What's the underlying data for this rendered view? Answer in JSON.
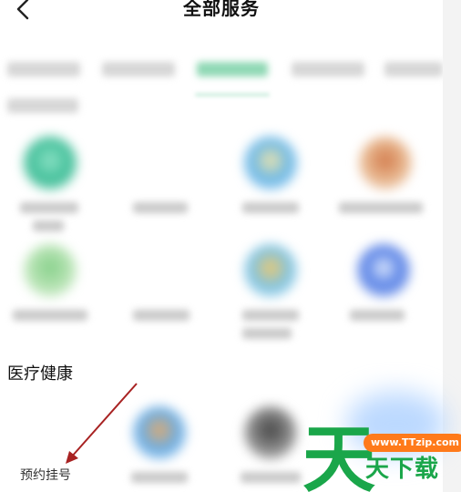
{
  "header": {
    "title": "全部服务",
    "back_icon": "chevron-left-icon"
  },
  "section": {
    "title": "医疗健康",
    "highlight_item_label": "预约挂号"
  },
  "annotation": {
    "arrow_color": "#a82222"
  },
  "watermark": {
    "url": "www.TTzip.com",
    "text": "天下载",
    "logo_glyph": "天",
    "green": "#1aa64a",
    "orange": "#ff7a1a"
  },
  "colors": {
    "background": "#ffffff",
    "accent_green": "#27b36b"
  }
}
